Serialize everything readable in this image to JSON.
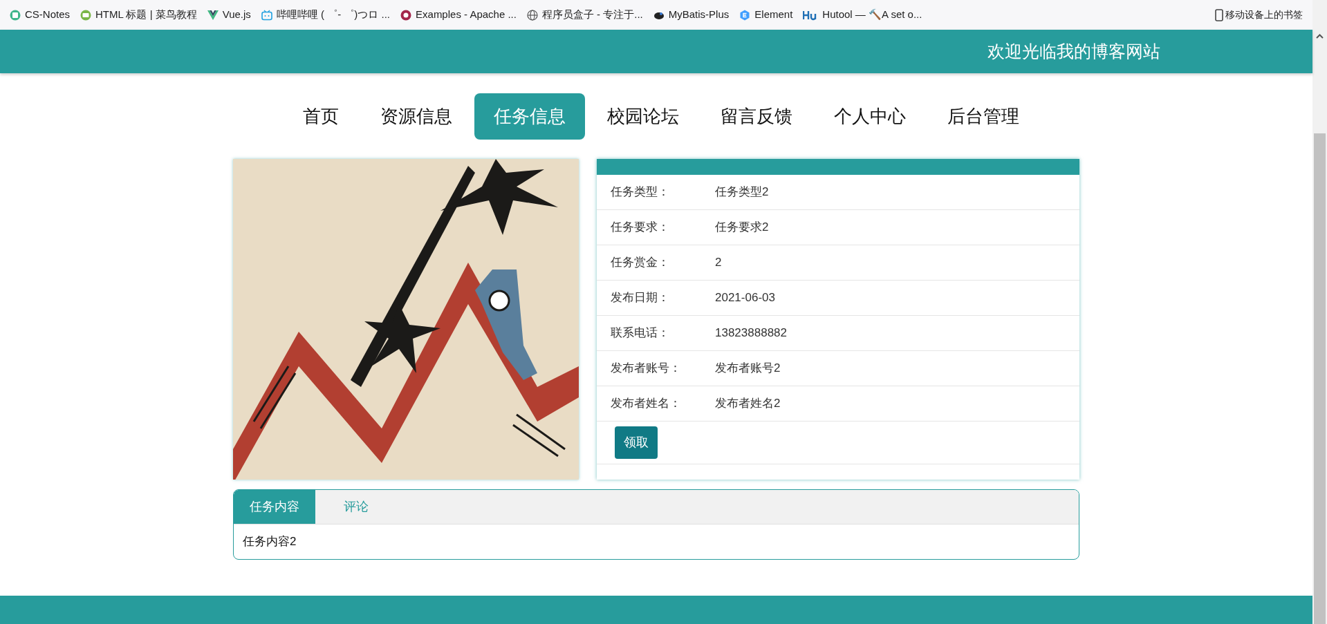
{
  "bookmarks": [
    {
      "label": "CS-Notes"
    },
    {
      "label": "HTML 标题 | 菜鸟教程"
    },
    {
      "label": "Vue.js"
    },
    {
      "label": "哔哩哔哩 ( ゜- ゜)つロ ..."
    },
    {
      "label": "Examples - Apache ..."
    },
    {
      "label": "程序员盒子 - 专注于..."
    },
    {
      "label": "MyBatis-Plus"
    },
    {
      "label": "Element"
    },
    {
      "label": "Hutool — 🔨A set o..."
    }
  ],
  "mobile_bookmarks": "移动设备上的书签",
  "site_title": "欢迎光临我的博客网站",
  "nav": [
    {
      "label": "首页",
      "selected": false
    },
    {
      "label": "资源信息",
      "selected": false
    },
    {
      "label": "任务信息",
      "selected": true
    },
    {
      "label": "校园论坛",
      "selected": false
    },
    {
      "label": "留言反馈",
      "selected": false
    },
    {
      "label": "个人中心",
      "selected": false
    },
    {
      "label": "后台管理",
      "selected": false
    }
  ],
  "details": [
    {
      "label": "任务类型：",
      "value": "任务类型2"
    },
    {
      "label": "任务要求：",
      "value": "任务要求2"
    },
    {
      "label": "任务赏金：",
      "value": "2"
    },
    {
      "label": "发布日期：",
      "value": "2021-06-03"
    },
    {
      "label": "联系电话：",
      "value": "13823888882"
    },
    {
      "label": "发布者账号：",
      "value": "发布者账号2"
    },
    {
      "label": "发布者姓名：",
      "value": "发布者姓名2"
    }
  ],
  "claim_button": "领取",
  "content_tabs": [
    {
      "label": "任务内容",
      "selected": true
    },
    {
      "label": "评论",
      "selected": false
    }
  ],
  "content_text": "任务内容2"
}
